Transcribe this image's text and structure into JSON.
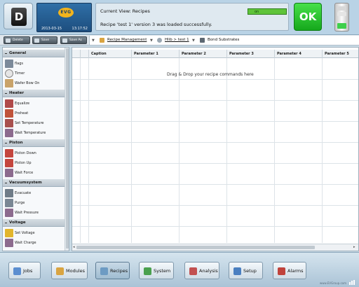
{
  "header": {
    "user_initial": "D",
    "logo_text": "EVG",
    "date": "2013-03-15",
    "time": "13:17:52",
    "current_view": "Current View: Recipes",
    "status_bar_label": "on",
    "message": "Recipe 'test 1' version 3 was loaded successfully.",
    "ok_label": "OK"
  },
  "toolbar": {
    "buttons": [
      "Delete",
      "Save",
      "Save As"
    ],
    "breadcrumbs": [
      "Recipe Management",
      "Hlib > test 1",
      "Bond Substrates"
    ]
  },
  "sidebar": {
    "categories": [
      {
        "title": "General",
        "items": [
          "flags",
          "Timer",
          "Wafer Bow On"
        ]
      },
      {
        "title": "Heater",
        "items": [
          "Equalize",
          "Preheat",
          "Set Temperature",
          "Wait Temperature"
        ]
      },
      {
        "title": "Piston",
        "items": [
          "Piston Down",
          "Piston Up",
          "Wait Force"
        ]
      },
      {
        "title": "Vacuumsystem",
        "items": [
          "Evacuate",
          "Purge",
          "Wait Pressure"
        ]
      },
      {
        "title": "Voltage",
        "items": [
          "Set Voltage",
          "Wait Charge"
        ]
      }
    ]
  },
  "table": {
    "columns": [
      "Caption",
      "Parameter 1",
      "Parameter 2",
      "Parameter 3",
      "Parameter 4",
      "Parameter 5"
    ],
    "drop_hint": "Drag & Drop your recipe commands here"
  },
  "bottom_nav": {
    "items": [
      "Jobs",
      "Modules",
      "Recipes",
      "System",
      "Analysis",
      "Setup",
      "Alarms"
    ],
    "active": "Recipes",
    "footer_url": "www.EVGroup.com"
  },
  "colors": {
    "ok_green": "#2ecb34",
    "header_blue": "#b9d3e6",
    "logo_blue": "#2561a0"
  }
}
